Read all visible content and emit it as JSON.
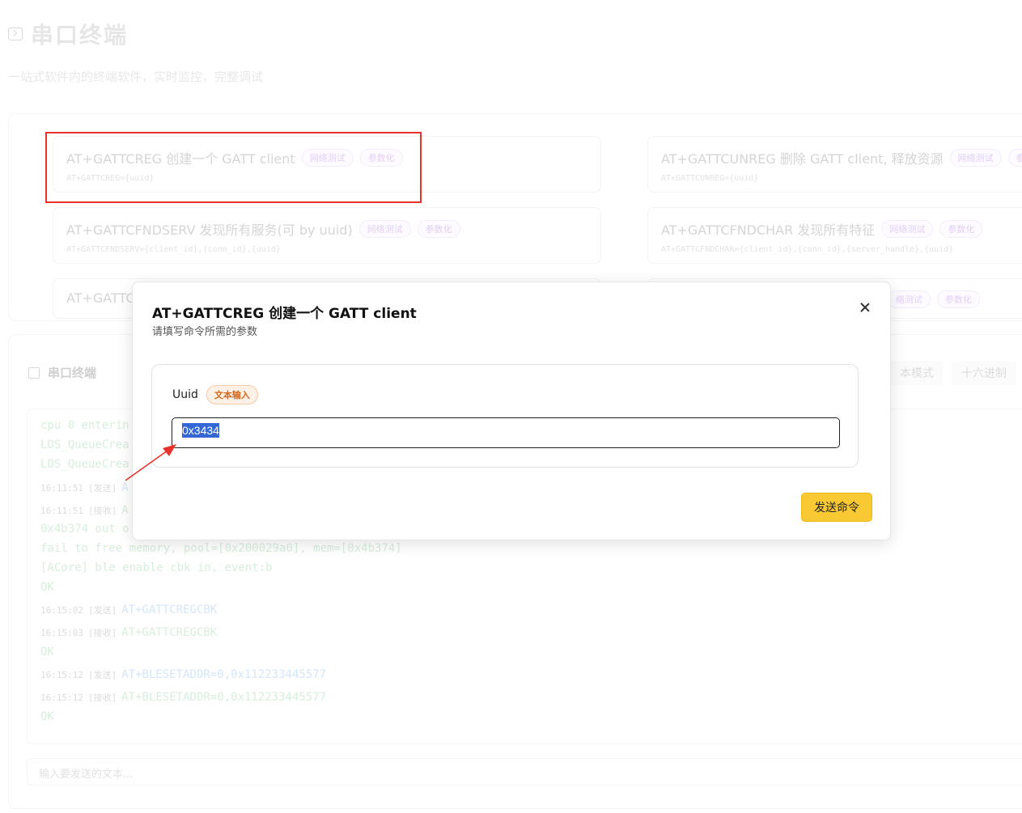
{
  "page": {
    "title": "串口终端",
    "subtitle": "一站式软件内的终端软件，实时监控，完整调试"
  },
  "commands": [
    {
      "title": "AT+GATTCREG 创建一个 GATT client",
      "syntax": "AT+GATTCREG={uuid}",
      "tags": [
        "网络测试",
        "参数化"
      ]
    },
    {
      "title": "AT+GATTCUNREG 删除 GATT client, 释放资源",
      "syntax": "AT+GATTCUNREG={uuid}",
      "tags": [
        "网络测试",
        "参数"
      ]
    },
    {
      "title": "AT+GATTCFNDSERV 发现所有服务(可 by uuid)",
      "syntax": "AT+GATTCFNDSERV={client_id},{conn_id},{uuid}",
      "tags": [
        "网络测试",
        "参数化"
      ]
    },
    {
      "title": "AT+GATTCFNDCHAR 发现所有特征",
      "syntax": "AT+GATTCFNDCHAR={client_id},{conn_id},{server_handle},{uuid}",
      "tags": [
        "网络测试",
        "参数化"
      ]
    },
    {
      "title": "AT+GATTCI",
      "syntax": "",
      "tags": []
    },
    {
      "title": "",
      "syntax": "",
      "tags": [
        "络测试",
        "参数化"
      ]
    }
  ],
  "terminal": {
    "title": "串口终端",
    "modes": [
      "本模式",
      "十六进制"
    ],
    "logs": [
      {
        "ts": "",
        "dir": "",
        "text": "cpu 0 enterin"
      },
      {
        "ts": "",
        "dir": "",
        "text": "LOS_QueueCrea"
      },
      {
        "ts": "",
        "dir": "",
        "text": "LOS_QueueCrea"
      },
      {
        "ts": "16:11:51",
        "dir": "[发送]",
        "text": "A"
      },
      {
        "ts": "16:11:51",
        "dir": "[接收]",
        "text": "A"
      },
      {
        "ts": "",
        "dir": "",
        "text": "0x4b374 out o"
      },
      {
        "ts": "",
        "dir": "",
        "text": "fail to free memory, pool=[0x200029a0], mem=[0x4b374]"
      },
      {
        "ts": "",
        "dir": "",
        "text": "[ACore] ble enable cbk in, event:b"
      },
      {
        "ts": "",
        "dir": "",
        "text": "OK"
      },
      {
        "ts": "16:15:02",
        "dir": "[发送]",
        "text": "AT+GATTCREGCBK"
      },
      {
        "ts": "16:15:03",
        "dir": "[接收]",
        "text": "AT+GATTCREGCBK"
      },
      {
        "ts": "",
        "dir": "",
        "text": "OK"
      },
      {
        "ts": "16:15:12",
        "dir": "[发送]",
        "text": "AT+BLESETADDR=0,0x112233445577"
      },
      {
        "ts": "16:15:12",
        "dir": "[接收]",
        "text": "AT+BLESETADDR=0,0x112233445577"
      },
      {
        "ts": "",
        "dir": "",
        "text": "OK"
      }
    ],
    "input_placeholder": "输入要发送的文本..."
  },
  "modal": {
    "title": "AT+GATTCREG 创建一个 GATT client",
    "subtitle": "请填写命令所需的参数",
    "param_label": "Uuid",
    "param_type": "文本输入",
    "param_value": "0x3434",
    "send_label": "发送命令"
  },
  "colors": {
    "highlight_border": "#e8322b",
    "send_button": "#f9c933",
    "selection": "#3367d6"
  }
}
